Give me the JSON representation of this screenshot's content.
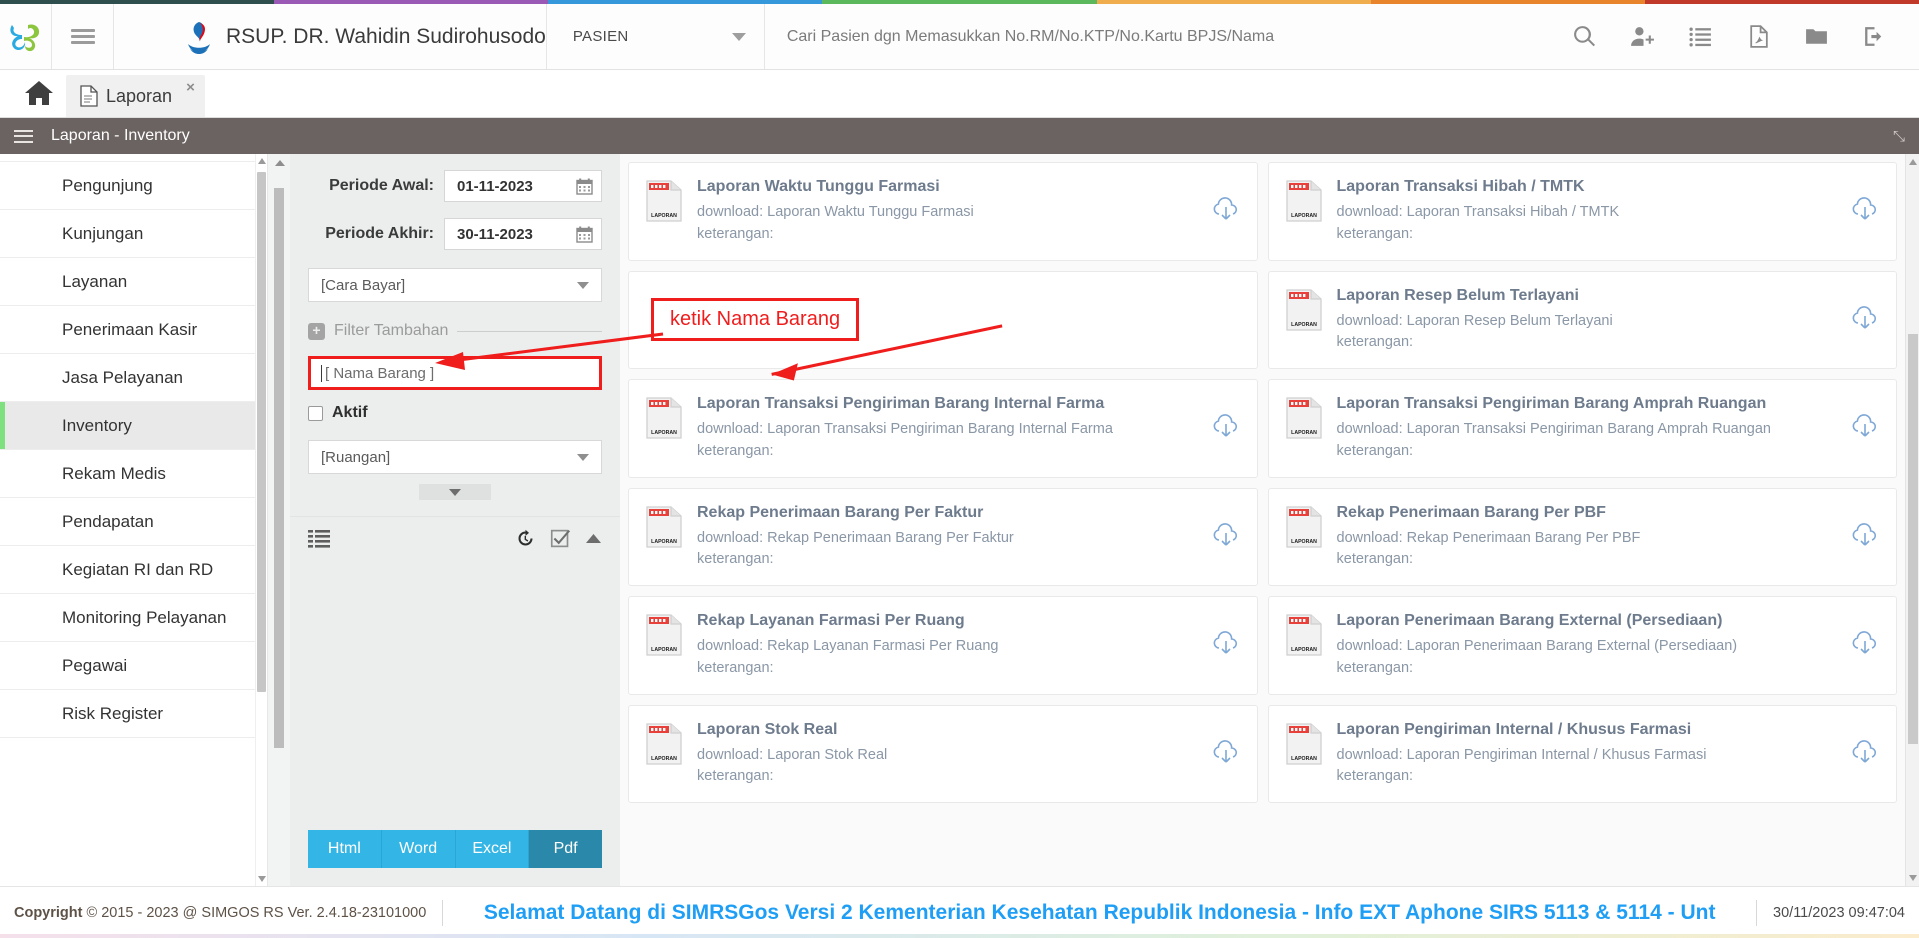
{
  "header": {
    "hospital_name": "RSUP. DR. Wahidin Sudirohusodo",
    "scope_label": "PASIEN",
    "search_placeholder": "Cari Pasien dgn Memasukkan No.RM/No.KTP/No.Kartu BPJS/Nama",
    "search_value": "",
    "icons": [
      "search-icon",
      "add-user-icon",
      "list-icon",
      "pdf-icon",
      "folder-icon",
      "logout-icon"
    ],
    "rainbow": [
      "#2f4f4f",
      "#9b59b6",
      "#3498db",
      "#5cb85c",
      "#f0ad4e",
      "#e8842c",
      "#c0392b"
    ]
  },
  "tabbar": {
    "home_label": "home-icon",
    "tab_label": "Laporan",
    "tab_close": "×"
  },
  "subheader": {
    "title": "Laporan - Inventory",
    "expand_icon": "expand-icon"
  },
  "sidebar": {
    "items": [
      {
        "label": "Pengunjung",
        "active": false
      },
      {
        "label": "Kunjungan",
        "active": false
      },
      {
        "label": "Layanan",
        "active": false
      },
      {
        "label": "Penerimaan Kasir",
        "active": false
      },
      {
        "label": "Jasa Pelayanan",
        "active": false
      },
      {
        "label": "Inventory",
        "active": true
      },
      {
        "label": "Rekam Medis",
        "active": false
      },
      {
        "label": "Pendapatan",
        "active": false
      },
      {
        "label": "Kegiatan RI dan RD",
        "active": false
      },
      {
        "label": "Monitoring Pelayanan",
        "active": false
      },
      {
        "label": "Pegawai",
        "active": false
      },
      {
        "label": "Risk Register",
        "active": false
      }
    ],
    "accent_color": "#7ee07e"
  },
  "filter": {
    "periode_awal_label": "Periode Awal:",
    "periode_awal_value": "01-11-2023",
    "periode_akhir_label": "Periode Akhir:",
    "periode_akhir_value": "30-11-2023",
    "cara_bayar_label": "[Cara Bayar]",
    "filter_tambahan_label": "Filter Tambahan",
    "nama_barang_placeholder": "[ Nama Barang ]",
    "nama_barang_value": "",
    "aktif_label": "Aktif",
    "aktif_checked": false,
    "ruangan_label": "[Ruangan]",
    "toolbar_icons": [
      "list-icon",
      "reset-history-icon",
      "check-all-icon",
      "collapse-icon"
    ],
    "export_buttons": [
      {
        "label": "Html",
        "active": false
      },
      {
        "label": "Word",
        "active": false
      },
      {
        "label": "Excel",
        "active": false
      },
      {
        "label": "Pdf",
        "active": true
      }
    ],
    "highlight_color": "#f01d1d"
  },
  "annotation": {
    "text": "ketik Nama Barang",
    "color": "#f01d1d"
  },
  "reports": {
    "download_prefix": "download: ",
    "keterangan_label": "keterangan:",
    "left_column": [
      {
        "title": "Laporan Waktu Tunggu Farmasi",
        "download": "download: Laporan Waktu Tunggu Farmasi",
        "keterangan": "keterangan:"
      },
      {
        "title": "Laporan Transaksi Pengiriman Barang Internal Farma",
        "download": "download: Laporan Transaksi Pengiriman Barang Internal Farma",
        "keterangan": "keterangan:"
      },
      {
        "title": "Rekap Penerimaan Barang Per Faktur",
        "download": "download: Rekap Penerimaan Barang Per Faktur",
        "keterangan": "keterangan:"
      },
      {
        "title": "Rekap Layanan Farmasi Per Ruang",
        "download": "download: Rekap Layanan Farmasi Per Ruang",
        "keterangan": "keterangan:"
      },
      {
        "title": "Laporan Stok Real",
        "download": "download: Laporan Stok Real",
        "keterangan": "keterangan:"
      }
    ],
    "right_column": [
      {
        "title": "Laporan Transaksi Hibah / TMTK",
        "download": "download: Laporan Transaksi Hibah / TMTK",
        "keterangan": "keterangan:"
      },
      {
        "title": "Laporan Resep Belum Terlayani",
        "download": "download: Laporan Resep Belum Terlayani",
        "keterangan": "keterangan:"
      },
      {
        "title": "Laporan Transaksi Pengiriman Barang Amprah Ruangan",
        "download": "download: Laporan Transaksi Pengiriman Barang Amprah Ruangan",
        "keterangan": "keterangan:"
      },
      {
        "title": "Rekap Penerimaan Barang Per PBF",
        "download": "download: Rekap Penerimaan Barang Per PBF",
        "keterangan": "keterangan:"
      },
      {
        "title": "Laporan Penerimaan Barang External (Persediaan)",
        "download": "download: Laporan Penerimaan Barang External (Persediaan)",
        "keterangan": "keterangan:"
      },
      {
        "title": "Laporan Pengiriman Internal / Khusus Farmasi",
        "download": "download: Laporan Pengiriman Internal / Khusus Farmasi",
        "keterangan": "keterangan:"
      }
    ],
    "icon_label": "LAPORAN"
  },
  "footer": {
    "copyright_bold": "Copyright",
    "copyright_rest": "2015 - 2023 @ SIMGOS RS Ver. 2.4.18-23101000",
    "marquee": "Selamat Datang di SIMRSGos Versi 2 Kementerian Kesehatan Republik Indonesia - Info EXT Aphone SIRS 5113 & 5114 - Unt",
    "datetime": "30/11/2023 09:47:04",
    "marquee_color": "#1e9ef5"
  }
}
